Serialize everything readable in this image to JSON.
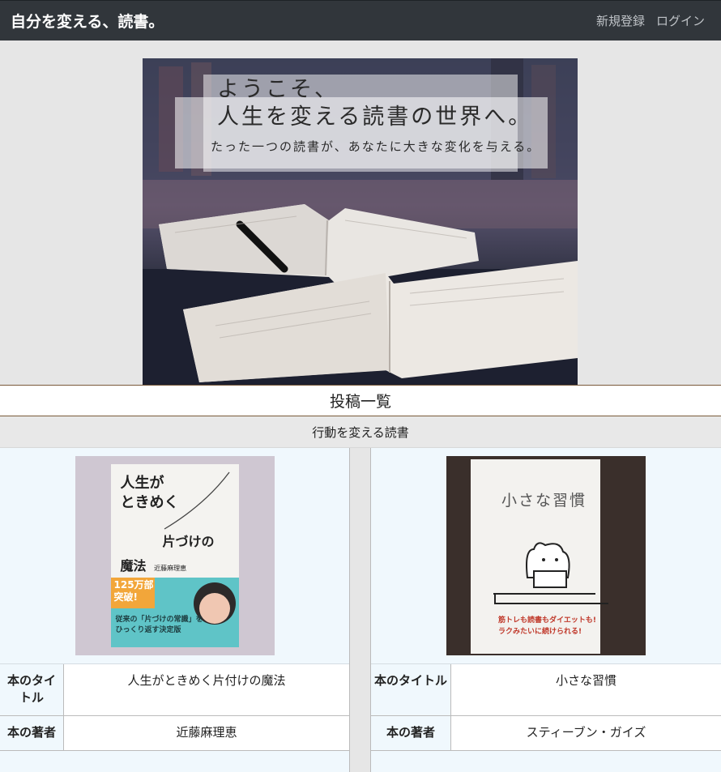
{
  "header": {
    "brand": "自分を変える、読書。",
    "nav": {
      "signup": "新規登録",
      "login": "ログイン"
    }
  },
  "hero": {
    "line1": "ようこそ、",
    "line2": "人生を変える読書の世界へ。",
    "line3": "たった一つの読書が、あなたに大きな変化を与える。"
  },
  "section": {
    "title": "投稿一覧",
    "subtitle": "行動を変える読書"
  },
  "posts": [
    {
      "title_label": "本のタイトル",
      "title": "人生がときめく片付けの魔法",
      "author_label": "本の著者",
      "author": "近藤麻理恵",
      "cover": {
        "line1": "人生が",
        "line2": "ときめく",
        "line3": "片づけの",
        "line4": "魔法",
        "author": "近藤麻理恵",
        "badge1": "125万部",
        "badge2": "突破!",
        "blurb1": "従来の「片づけの常識」を",
        "blurb2": "ひっくり返す決定版"
      }
    },
    {
      "title_label": "本のタイトル",
      "title": "小さな習慣",
      "author_label": "本の著者",
      "author": "スティーブン・ガイズ",
      "cover": {
        "title": "小さな習慣",
        "tagline1": "筋トレも読書もダイエットも!",
        "tagline2": "ラクみたいに続けられる!"
      }
    }
  ],
  "colors": {
    "header_bg": "#31363b",
    "card_bg": "#f0f8fd",
    "accent_border": "#7a5a3a"
  }
}
